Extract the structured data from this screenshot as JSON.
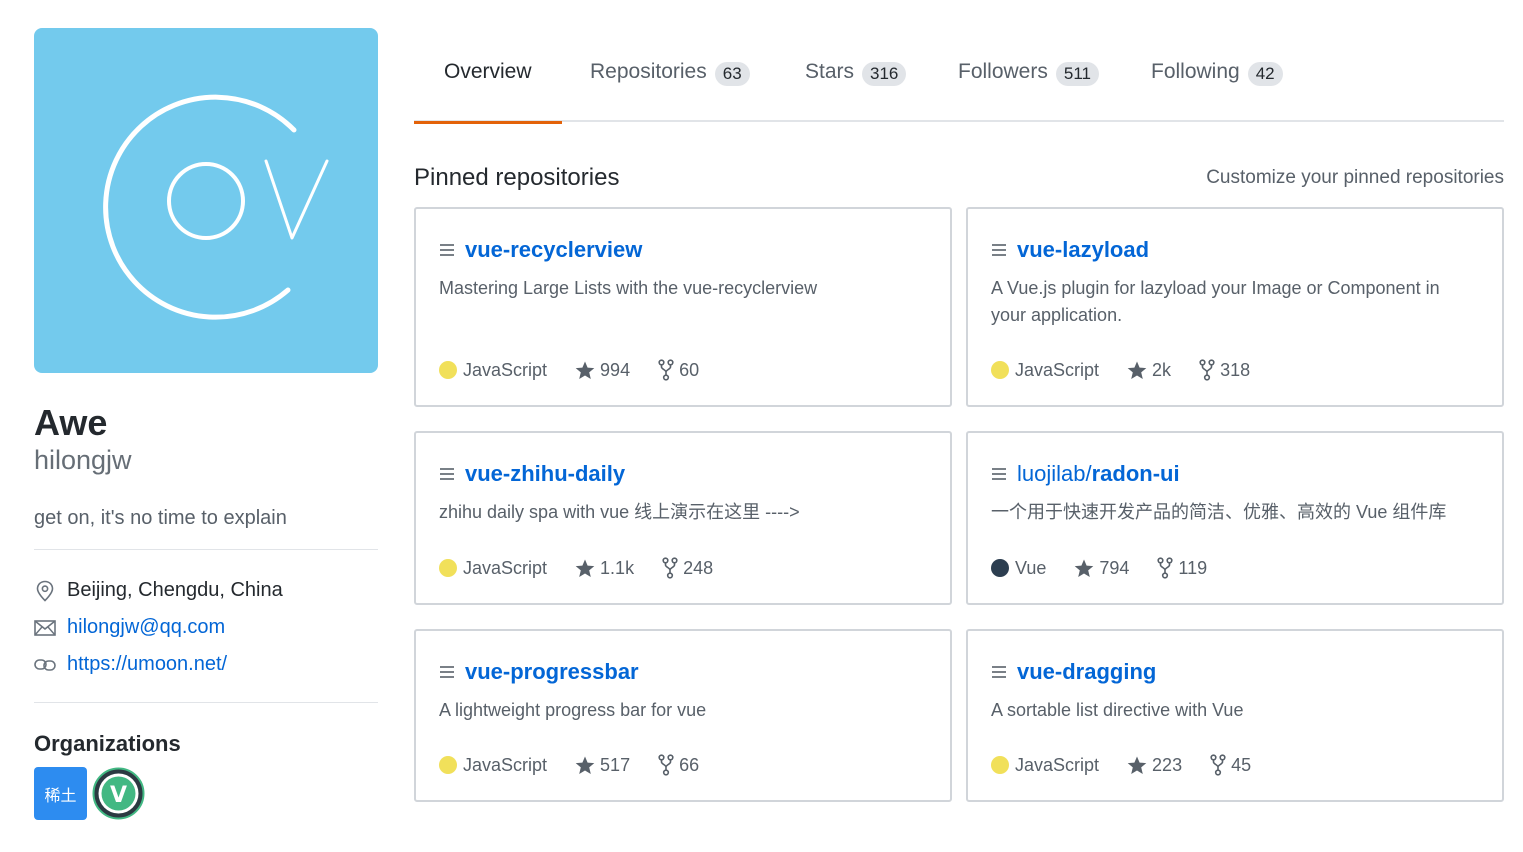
{
  "profile": {
    "name": "Awe",
    "login": "hilongjw",
    "bio": "get on, it's no time to explain",
    "location": "Beijing, Chengdu, China",
    "email": "hilongjw@qq.com",
    "website": "https://umoon.net/",
    "avatar_color": "#73caed"
  },
  "organizations": {
    "title": "Organizations",
    "items": [
      {
        "label": "稀土",
        "color": "#2d8cf0"
      },
      {
        "label": "V",
        "color": "#42b883"
      }
    ]
  },
  "tabs": [
    {
      "label": "Overview",
      "count": ""
    },
    {
      "label": "Repositories",
      "count": "63"
    },
    {
      "label": "Stars",
      "count": "316"
    },
    {
      "label": "Followers",
      "count": "511"
    },
    {
      "label": "Following",
      "count": "42"
    }
  ],
  "pinned": {
    "title": "Pinned repositories",
    "customize_label": "Customize your pinned repositories",
    "repos": [
      {
        "owner": "",
        "name": "vue-recyclerview",
        "description": "Mastering Large Lists with the vue-recyclerview",
        "language": "JavaScript",
        "language_color": "#f1e05a",
        "stars": "994",
        "forks": "60"
      },
      {
        "owner": "",
        "name": "vue-lazyload",
        "description": "A Vue.js plugin for lazyload your Image or Component in your application.",
        "language": "JavaScript",
        "language_color": "#f1e05a",
        "stars": "2k",
        "forks": "318"
      },
      {
        "owner": "",
        "name": "vue-zhihu-daily",
        "description": "zhihu daily spa with vue 线上演示在这里 ---->",
        "language": "JavaScript",
        "language_color": "#f1e05a",
        "stars": "1.1k",
        "forks": "248"
      },
      {
        "owner": "luojilab/",
        "name": "radon-ui",
        "description": "一个用于快速开发产品的简洁、优雅、高效的 Vue 组件库",
        "language": "Vue",
        "language_color": "#2c3e50",
        "stars": "794",
        "forks": "119"
      },
      {
        "owner": "",
        "name": "vue-progressbar",
        "description": "A lightweight progress bar for vue",
        "language": "JavaScript",
        "language_color": "#f1e05a",
        "stars": "517",
        "forks": "66"
      },
      {
        "owner": "",
        "name": "vue-dragging",
        "description": "A sortable list directive with Vue",
        "language": "JavaScript",
        "language_color": "#f1e05a",
        "stars": "223",
        "forks": "45"
      }
    ]
  },
  "icons": {
    "location": "location-pin-icon",
    "email": "mail-icon",
    "website": "link-icon",
    "repo": "repo-icon",
    "star": "star-icon",
    "fork": "fork-icon"
  }
}
